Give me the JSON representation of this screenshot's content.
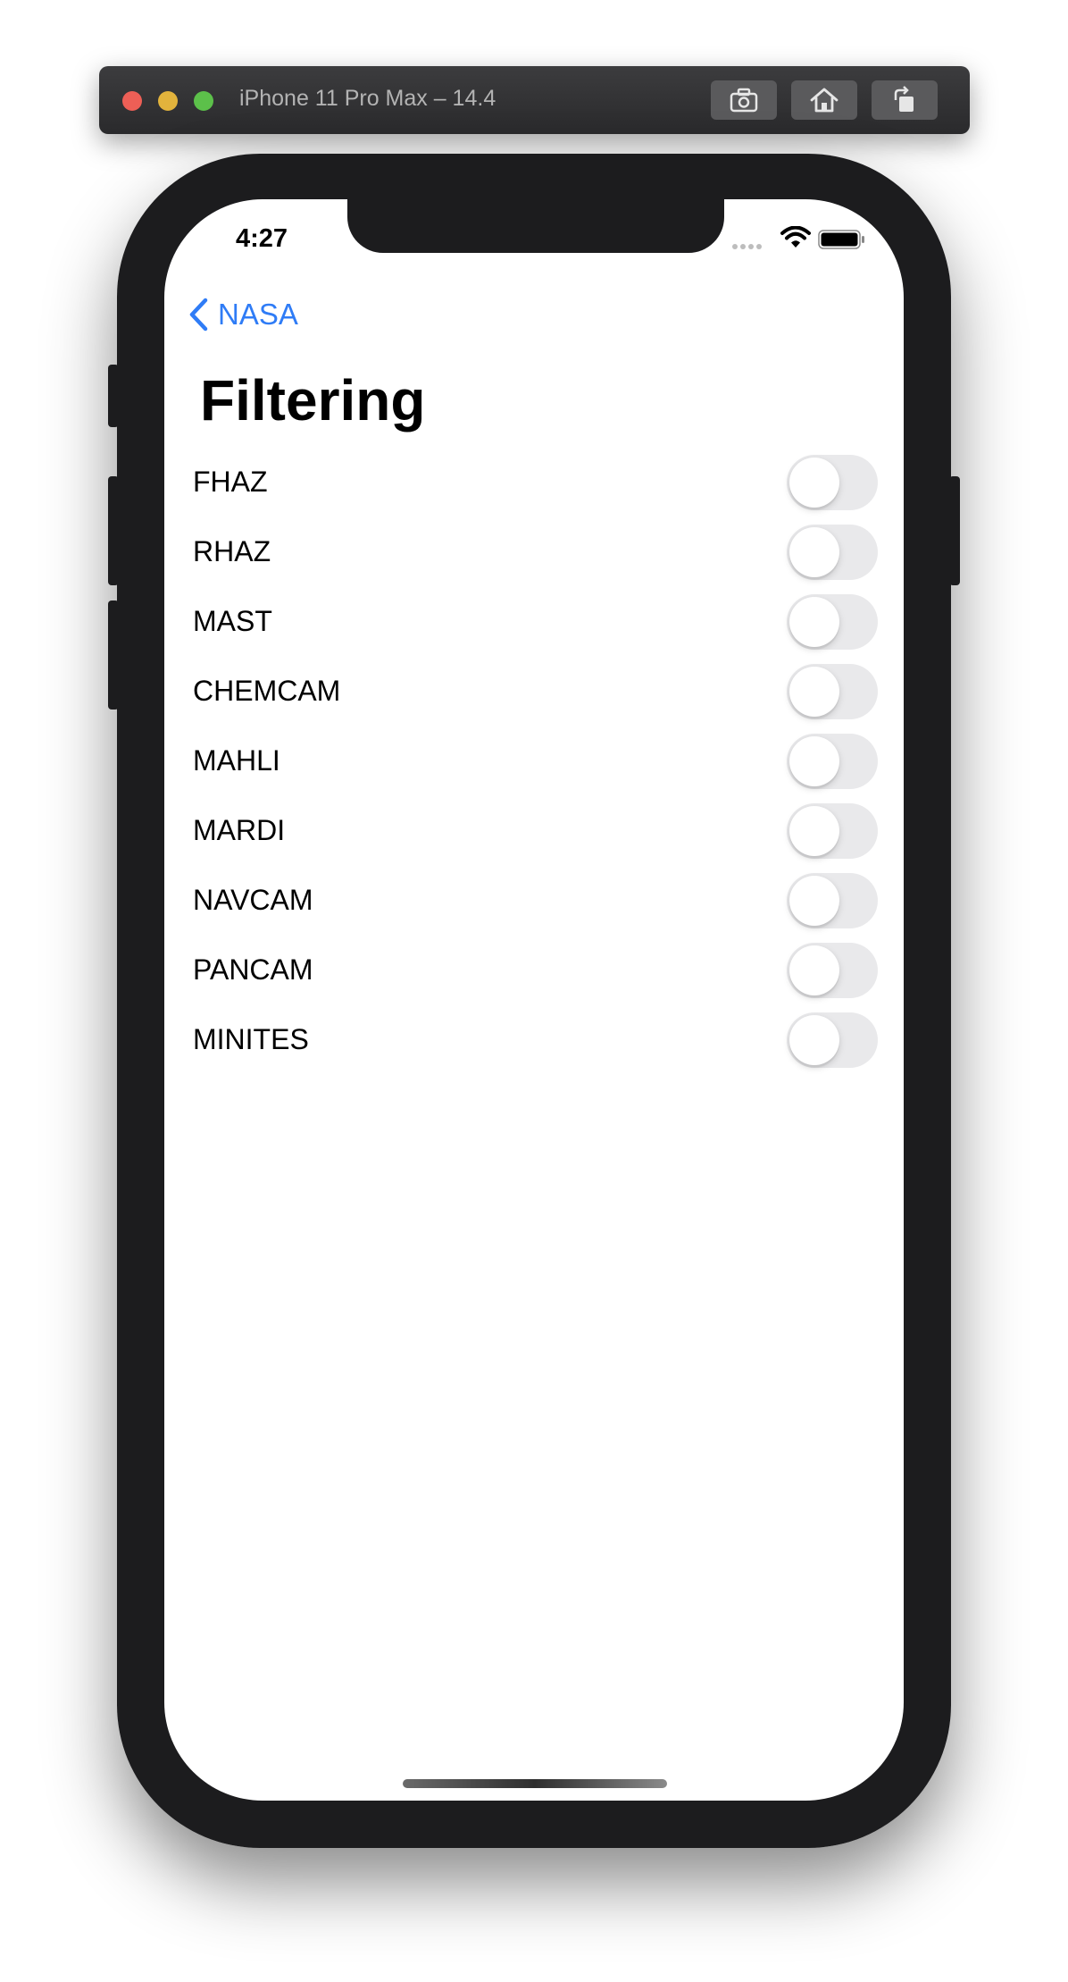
{
  "simulator": {
    "title": "iPhone 11 Pro Max – 14.4",
    "buttons": [
      "screenshot-icon",
      "home-icon",
      "rotate-icon"
    ]
  },
  "status_bar": {
    "time": "4:27"
  },
  "nav": {
    "back_label": "NASA"
  },
  "page": {
    "title": "Filtering"
  },
  "filters": [
    {
      "label": "FHAZ",
      "on": false
    },
    {
      "label": "RHAZ",
      "on": false
    },
    {
      "label": "MAST",
      "on": false
    },
    {
      "label": "CHEMCAM",
      "on": false
    },
    {
      "label": "MAHLI",
      "on": false
    },
    {
      "label": "MARDI",
      "on": false
    },
    {
      "label": "NAVCAM",
      "on": false
    },
    {
      "label": "PANCAM",
      "on": false
    },
    {
      "label": "MINITES",
      "on": false
    }
  ],
  "colors": {
    "accent": "#2f7cf6",
    "toggle_off": "#e9e9eb",
    "bezel": "#1c1c1e"
  }
}
